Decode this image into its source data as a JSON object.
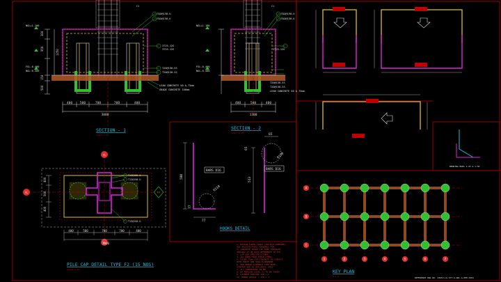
{
  "colors": {
    "background": "#000000",
    "frame": "#c00000",
    "dim": "#d8d8d8",
    "magenta": "#e020e0",
    "yellow": "#e0c020",
    "cyan": "#20c0e0",
    "green": "#30c030",
    "red": "#e03030",
    "concrete": "#b05a28"
  },
  "section1": {
    "title": "SECTION - 1",
    "scale": "SCALE 1:25",
    "dims_bottom": [
      "400",
      "500",
      "700",
      "700",
      "400"
    ],
    "dims_total": "3000",
    "levels": [
      "NGL+1.100",
      "FGL-0.400",
      "NGL-0.500"
    ],
    "dims_left": [
      "300",
      "950",
      "1250",
      "150",
      "500"
    ],
    "notes": [
      "T12@150-U",
      "T12@150-U",
      "3T25-12S",
      "3T25-12S",
      "T20@150-SS",
      "T20@150-SS",
      "LEAN CONCRETE 50 & 75mm",
      "GRADE CONCRETE 100mm"
    ],
    "cl_label": "C1"
  },
  "section2": {
    "title": "SECTION - 2",
    "scale": "SCALE 1:25",
    "dims_bottom": [
      "400",
      "500",
      "400"
    ],
    "dims_total": "1300",
    "levels": [
      "NGL+1.100",
      "FGL-0.400",
      "NGL-0.500"
    ],
    "notes": [
      "T12@150-U",
      "T12@150-U",
      "3T25-12S",
      "T20@150-SS",
      "T20@150-SS",
      "LEAN CONCRETE 50 & 75mm"
    ],
    "cl_label": "C1"
  },
  "hooks": {
    "title": "HOOKS DETAIL",
    "bar_a": "BARS D16",
    "bar_b": "BARS D16",
    "dims": [
      "580",
      "77",
      "77",
      "R110",
      "65",
      "513",
      "R150",
      "65"
    ]
  },
  "plan": {
    "title": "PILE CAP DETAIL TYPE F2 (15 NOS)",
    "scale": "SCALE 1:25",
    "dims_bottom": [
      "400",
      "500",
      "700",
      "700",
      "400"
    ],
    "dims_total": "3000",
    "dims_left": [
      "400",
      "500",
      "400"
    ],
    "notes": [
      "T12@150-U",
      "T12@150-U",
      "T12@150-U"
    ],
    "markers": [
      "CL",
      "CL",
      "CL",
      "CL"
    ],
    "tag": "F2"
  },
  "key_plan": {
    "title": "KEY PLAN",
    "scale": "N.T.S",
    "rows": [
      "A",
      "B",
      "C"
    ],
    "cols": [
      "1",
      "2",
      "3",
      "4",
      "5",
      "6",
      "7"
    ]
  },
  "notes_block": {
    "lines": [
      "1. DESIGN TAKEN LOADS (PROJECT PREPARE),",
      "   SEE ARCHITECTURAL DRAWINGS FOR",
      "2. CONCRETE GRADE C40 CUBE STRENGTH",
      "   40N/mm2 AT 28 DAYS REFERENCE TO ITS",
      "3. LAP SEE SPECIFICATIONS",
      "4. ALL BARS HIGH YIELD STEEL",
      "5. COVER 75mm FOR CONCRETE IN CONTACT",
      "   WITH EARTH AND 50mm ELSEWHERE",
      "6. SEE REBAR SCHEDULE (SEE NOTE),",
      "   STARTER BAR AS PER ARCH. SPEC",
      "7. ALL DIMENSIONS IN MM",
      "8. NO REDUCED LEVEL IS TO BE TAKEN",
      "9. STIRRUP SPACING 150 C/C",
      "10. REBAR DETAIL = 150 x 1"
    ]
  },
  "footer_ref": "REFERENCE DWG NO. 22653-LG-STT-G-GNC-G-EPP-0101",
  "detail_small": "BENDING BARS 1:25 & 1:50"
}
